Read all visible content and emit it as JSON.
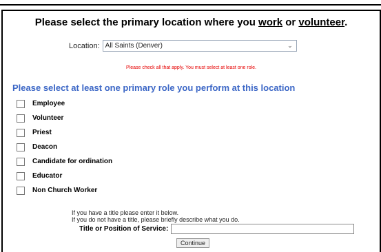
{
  "form": {
    "heading_part1": "Please select the primary location where you ",
    "heading_work": "work",
    "heading_or": " or ",
    "heading_volunteer": "volunteer",
    "heading_end": ".",
    "location_label": "Location:",
    "location_value": "All Saints (Denver)",
    "warning": "Please check all that apply. You must select at least one role.",
    "role_heading": "Please select at least one primary role you perform at this location",
    "roles": [
      {
        "label": "Employee"
      },
      {
        "label": "Volunteer"
      },
      {
        "label": "Priest"
      },
      {
        "label": "Deacon"
      },
      {
        "label": "Candidate for ordination"
      },
      {
        "label": "Educator"
      },
      {
        "label": "Non Church Worker"
      }
    ],
    "hint_line1": "If you have a title please enter it below.",
    "hint_line2": "If you do not have a title, please briefly describe what you do.",
    "title_label": "Title or Position of Service:",
    "title_value": "",
    "continue_label": "Continue"
  }
}
